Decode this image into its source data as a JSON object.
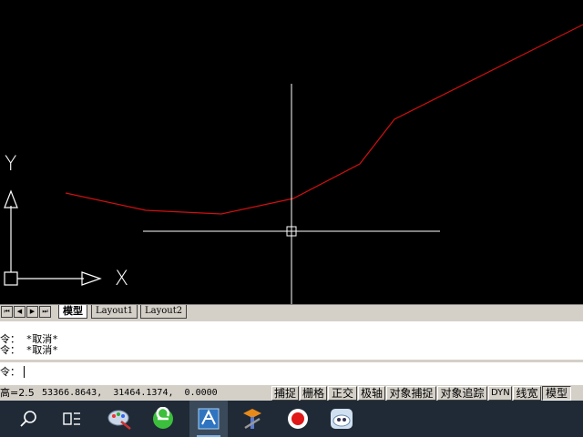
{
  "canvas": {
    "ucs_y_label": "Y",
    "ucs_x_label": "X",
    "polyline_color": "#d01010",
    "crosshair_color": "#ffffff",
    "background": "#000000"
  },
  "layout_tabs": {
    "nav_buttons": [
      "⏮",
      "◀",
      "▶",
      "⏭"
    ],
    "tabs": [
      {
        "label": "模型",
        "active": true
      },
      {
        "label": "Layout1",
        "active": false
      },
      {
        "label": "Layout2",
        "active": false
      }
    ]
  },
  "command": {
    "line1": "令： *取消*",
    "line2": "令： *取消*",
    "prompt": "令："
  },
  "status": {
    "text_height": "高=2.5",
    "coordinates": "53366.8643,  31464.1374,  0.0000",
    "toggles": [
      {
        "label": "捕捉",
        "pressed": false
      },
      {
        "label": "栅格",
        "pressed": false
      },
      {
        "label": "正交",
        "pressed": false
      },
      {
        "label": "极轴",
        "pressed": false
      },
      {
        "label": "对象捕捉",
        "pressed": false
      },
      {
        "label": "对象追踪",
        "pressed": false
      },
      {
        "label": "DYN",
        "pressed": false
      },
      {
        "label": "线宽",
        "pressed": false
      },
      {
        "label": "模型",
        "pressed": true
      }
    ]
  },
  "taskbar": {
    "items": [
      {
        "icon": "search-icon"
      },
      {
        "icon": "task-view-icon"
      },
      {
        "icon": "paint-app-icon"
      },
      {
        "icon": "browser-app-icon"
      },
      {
        "icon": "cad-app-icon"
      },
      {
        "icon": "tools-app-icon"
      },
      {
        "icon": "record-app-icon"
      },
      {
        "icon": "cloud-app-icon"
      }
    ]
  }
}
